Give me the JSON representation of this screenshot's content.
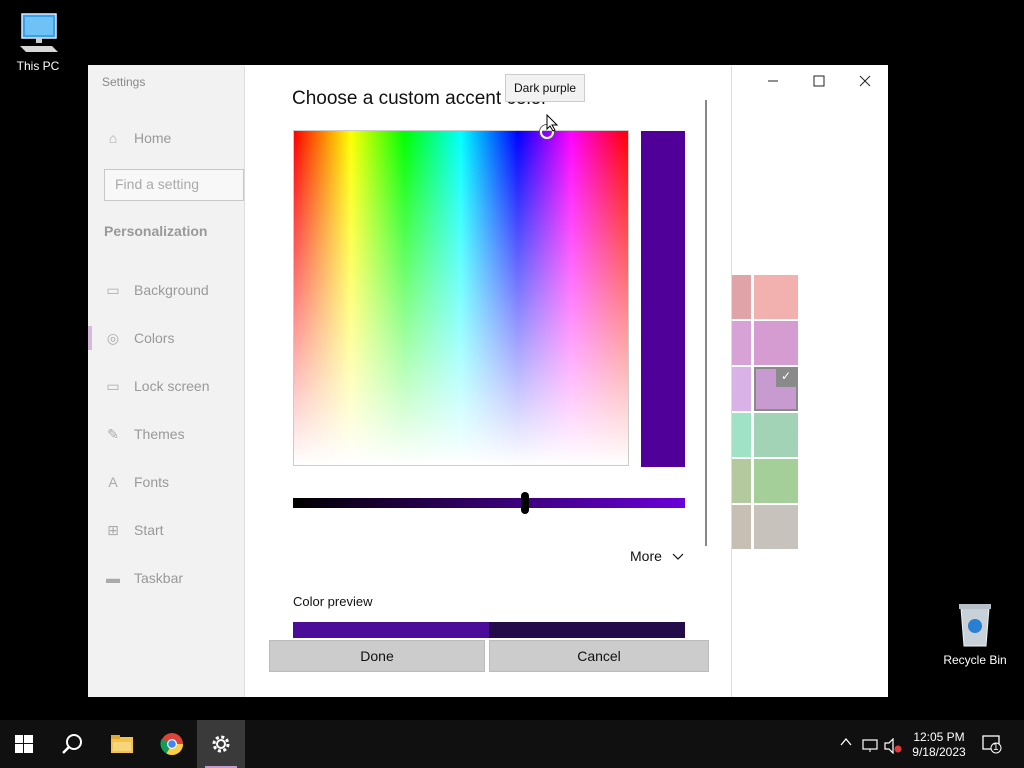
{
  "desktop": {
    "icons": [
      {
        "label": "This PC"
      },
      {
        "label": "Recycle Bin"
      }
    ]
  },
  "settings": {
    "title": "Settings",
    "search_placeholder": "Find a setting",
    "home_label": "Home",
    "section_heading": "Personalization",
    "nav": [
      {
        "label": "Background",
        "icon": "image-icon"
      },
      {
        "label": "Colors",
        "icon": "palette-icon",
        "selected": true
      },
      {
        "label": "Lock screen",
        "icon": "lock-screen-icon"
      },
      {
        "label": "Themes",
        "icon": "brush-icon"
      },
      {
        "label": "Fonts",
        "icon": "font-icon"
      },
      {
        "label": "Start",
        "icon": "start-icon"
      },
      {
        "label": "Taskbar",
        "icon": "taskbar-icon"
      }
    ],
    "window_controls": [
      "minimize",
      "maximize",
      "close"
    ],
    "swatch_colors": [
      "#e0a3a8",
      "#f2b1ae",
      "#d7a3d6",
      "#d49cd1",
      "#d9b2e7",
      "#c79bcf",
      "#9fe2c5",
      "#a3d3b7",
      "#b5c99f",
      "#a4cf99",
      "#c7bfb3",
      "#c7c3bc"
    ]
  },
  "dialog": {
    "title": "Choose a custom accent color",
    "selected_color": "#500099",
    "slider_gradient_end": "#6a00d9",
    "more_label": "More",
    "preview_label": "Color preview",
    "preview_colors": [
      "#4b0c9a",
      "#240c4a"
    ],
    "done_label": "Done",
    "cancel_label": "Cancel"
  },
  "tooltip": {
    "text": "Dark purple"
  },
  "taskbar": {
    "clock_time": "12:05 PM",
    "clock_date": "9/18/2023",
    "notification_count": "1",
    "accent_color": "#c49bd3"
  }
}
